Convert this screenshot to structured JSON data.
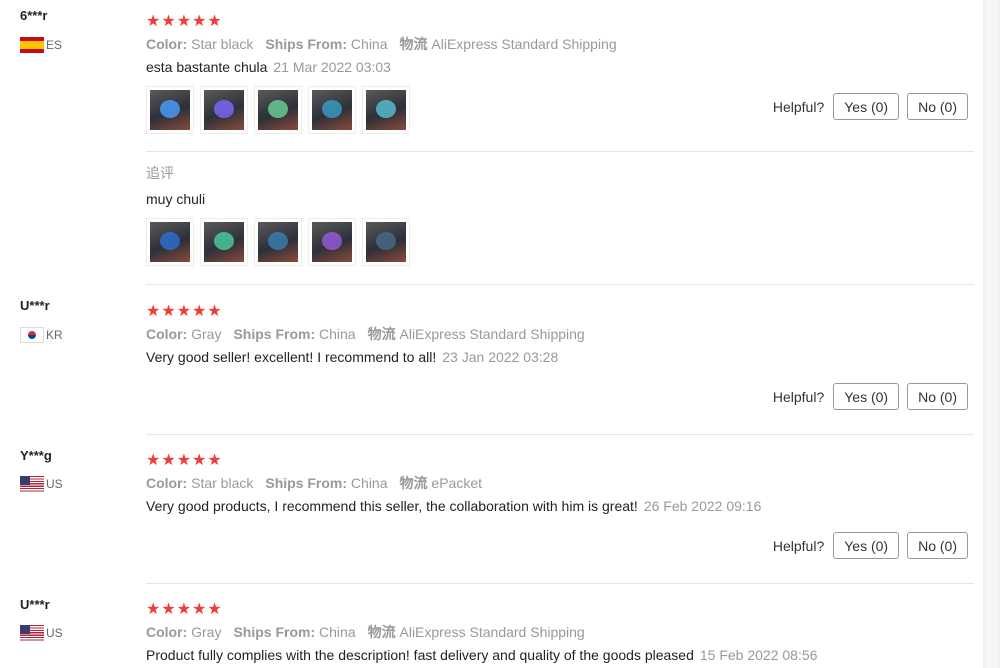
{
  "labels": {
    "color": "Color:",
    "ships_from": "Ships From:",
    "shipping_tag": "物流",
    "helpful": "Helpful?",
    "append": "追评"
  },
  "reviews": [
    {
      "user": "6***r",
      "country": "ES",
      "stars": "★★★★★",
      "color": "Star black",
      "ships_from": "China",
      "shipping": "AliExpress Standard Shipping",
      "text": "esta bastante chula",
      "date": "21 Mar 2022 03:03",
      "yes": "Yes (0)",
      "no": "No (0)",
      "append_text": "muy chuli"
    },
    {
      "user": "U***r",
      "country": "KR",
      "stars": "★★★★★",
      "color": "Gray",
      "ships_from": "China",
      "shipping": "AliExpress Standard Shipping",
      "text": "Very good seller! excellent! I recommend to all!",
      "date": "23 Jan 2022 03:28",
      "yes": "Yes (0)",
      "no": "No (0)"
    },
    {
      "user": "Y***g",
      "country": "US",
      "stars": "★★★★★",
      "color": "Star black",
      "ships_from": "China",
      "shipping": "ePacket",
      "text": "Very good products, I recommend this seller, the collaboration with him is great!",
      "date": "26 Feb 2022 09:16",
      "yes": "Yes (0)",
      "no": "No (0)"
    },
    {
      "user": "U***r",
      "country": "US",
      "stars": "★★★★★",
      "color": "Gray",
      "ships_from": "China",
      "shipping": "AliExpress Standard Shipping",
      "text": "Product fully complies with the description! fast delivery and quality of the goods pleased",
      "date": "15 Feb 2022 08:56"
    }
  ],
  "colors": {
    "star": "#ef3c3c",
    "muted": "#999999",
    "border": "#999999"
  }
}
